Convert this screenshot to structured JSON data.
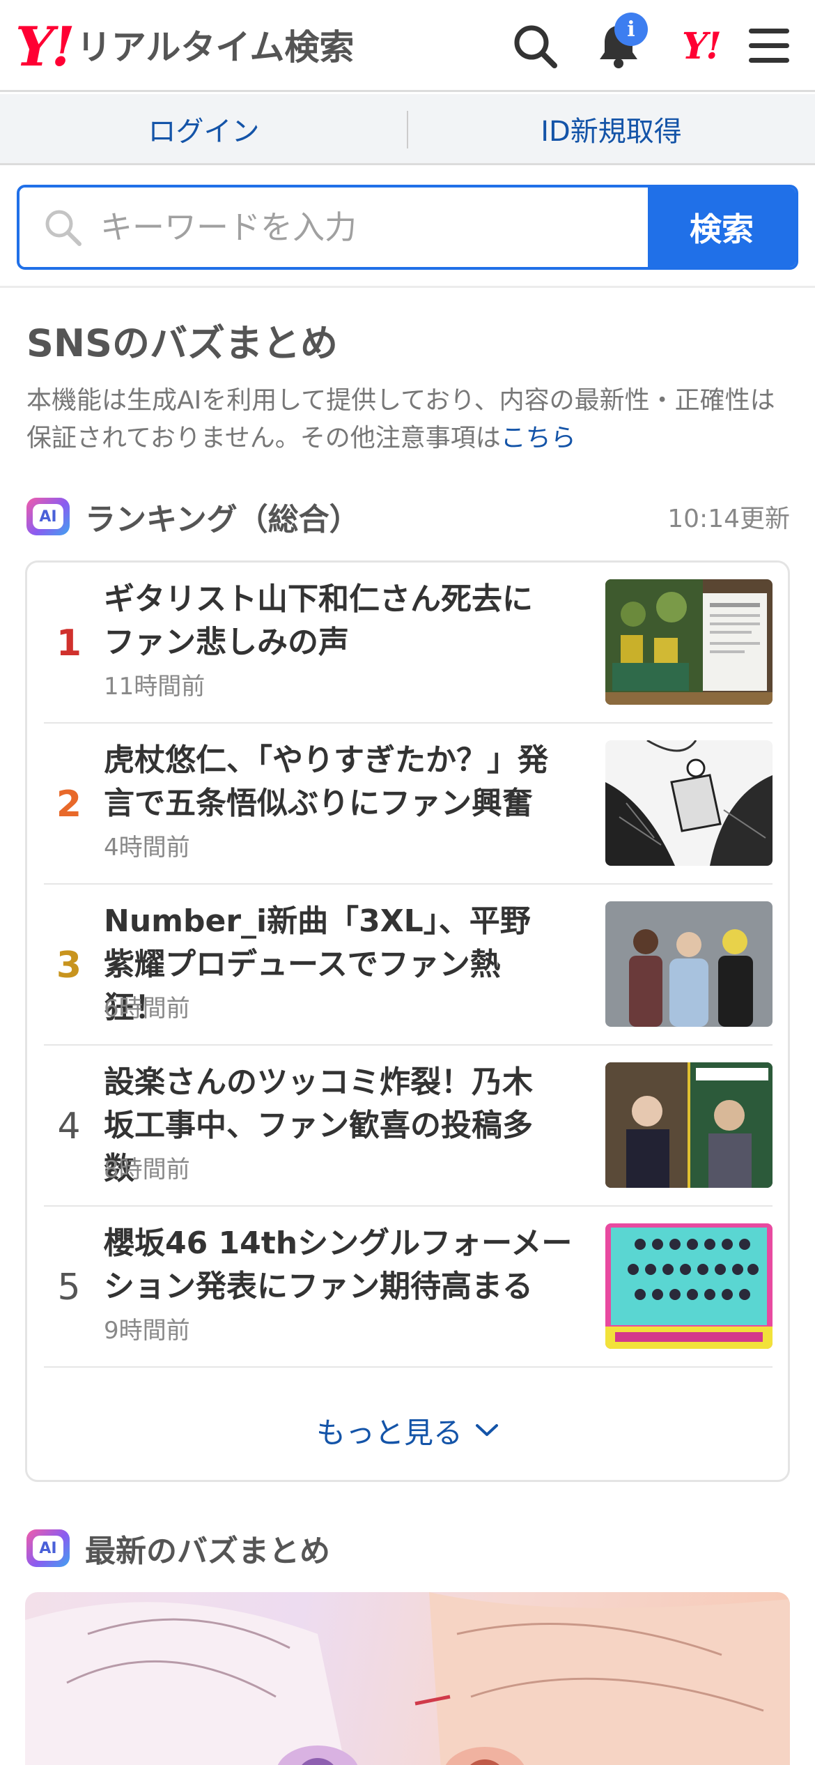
{
  "header": {
    "logo_mark": "Y!",
    "logo_text": "リアルタイム検索",
    "notification_badge": "i",
    "yahoo_mark": "Y!"
  },
  "login": {
    "login_label": "ログイン",
    "register_label": "ID新規取得"
  },
  "search": {
    "placeholder": "キーワードを入力",
    "button_label": "検索"
  },
  "section": {
    "title": "SNSのバズまとめ",
    "notice_text": "本機能は生成AIを利用して提供しており、内容の最新性・正確性は保証されておりません。その他注意事項は",
    "notice_link": "こちら"
  },
  "ranking": {
    "ai_label": "AI",
    "title": "ランキング（総合）",
    "updated": "10:14更新",
    "items": [
      {
        "rank": "1",
        "headline": "ギタリスト山下和仁さん死去にファン悲しみの声",
        "time": "11時間前"
      },
      {
        "rank": "2",
        "headline": "虎杖悠仁、「やりすぎたか？」発言で五条悟似ぶりにファン興奮",
        "time": "4時間前"
      },
      {
        "rank": "3",
        "headline": "Number_i新曲「3XL」、平野紫耀プロデュースでファン熱狂！",
        "time": "6時間前"
      },
      {
        "rank": "4",
        "headline": "設楽さんのツッコミ炸裂！乃木坂工事中、ファン歓喜の投稿多数",
        "time": "8時間前"
      },
      {
        "rank": "5",
        "headline": "櫻坂46 14thシングルフォーメーション発表にファン期待高まる",
        "time": "9時間前"
      }
    ],
    "more_label": "もっと見る"
  },
  "latest": {
    "ai_label": "AI",
    "title": "最新のバズまとめ"
  },
  "colors": {
    "brand_red": "#ff0033",
    "accent_blue": "#2070e8",
    "link_blue": "#1454a8",
    "rank1": "#d0312d",
    "rank2": "#e8692a",
    "rank3": "#c8941e"
  }
}
